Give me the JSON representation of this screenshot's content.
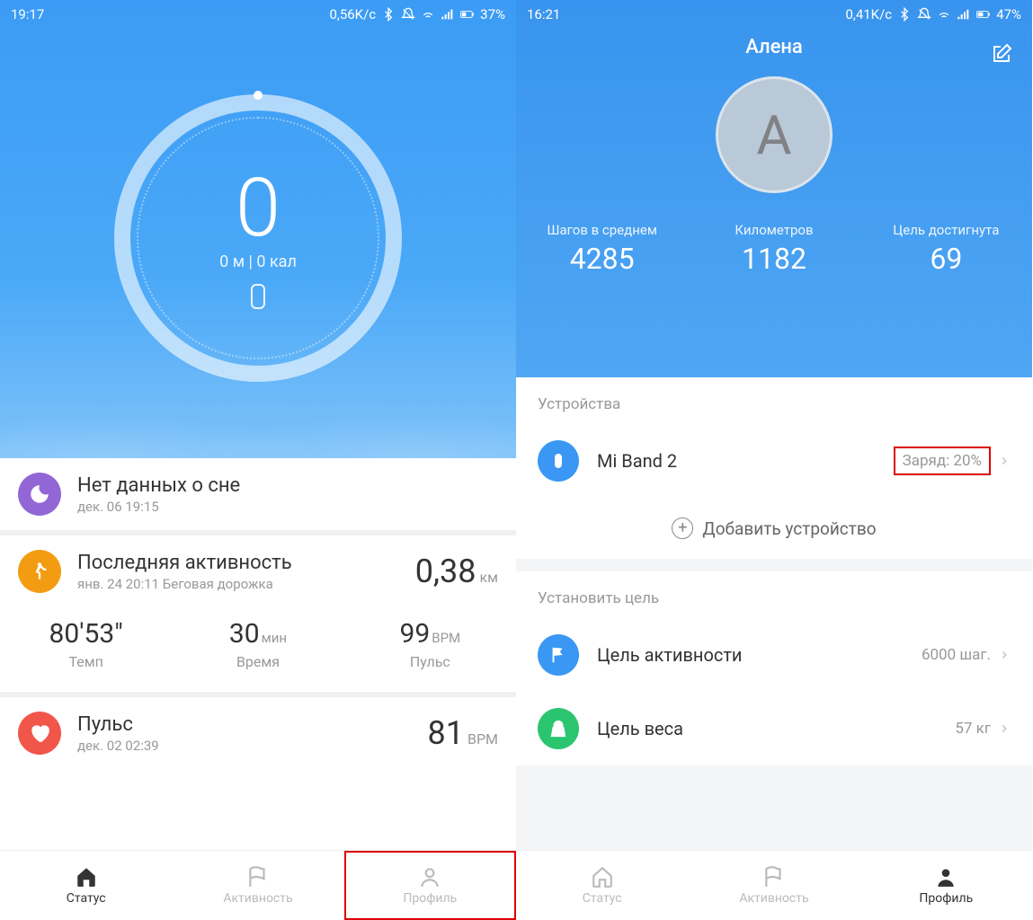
{
  "left": {
    "status": {
      "time": "19:17",
      "speed": "0,56K/c",
      "battery": "37%"
    },
    "hero": {
      "steps": "0",
      "sub": "0 м | 0 кал"
    },
    "sleep": {
      "title": "Нет данных о сне",
      "sub": "дек. 06 19:15"
    },
    "activity": {
      "title": "Последняя активность",
      "sub": "янв. 24 20:11 Беговая дорожка",
      "distance": "0,38",
      "distance_unit": "км"
    },
    "stats": {
      "pace": {
        "val": "80'53\"",
        "lab": "Темп"
      },
      "time": {
        "val": "30",
        "unit": "мин",
        "lab": "Время"
      },
      "bpm": {
        "val": "99",
        "unit": "BPM",
        "lab": "Пульс"
      }
    },
    "pulse": {
      "title": "Пульс",
      "sub": "дек. 02 02:39",
      "val": "81",
      "unit": "BPM"
    },
    "nav": {
      "status": "Статус",
      "activity": "Активность",
      "profile": "Профиль"
    }
  },
  "right": {
    "status": {
      "time": "16:21",
      "speed": "0,41K/c",
      "battery": "47%"
    },
    "profile_name": "Алена",
    "avatar_initial": "А",
    "hero_stats": {
      "s1": {
        "lab": "Шагов в среднем",
        "val": "4285"
      },
      "s2": {
        "lab": "Километров",
        "val": "1182"
      },
      "s3": {
        "lab": "Цель достигнута",
        "val": "69"
      }
    },
    "devices_header": "Устройства",
    "device": {
      "name": "Mi Band 2",
      "charge": "Заряд: 20%"
    },
    "add_device": "Добавить устройство",
    "goal_header": "Установить цель",
    "goal_activity": {
      "name": "Цель активности",
      "val": "6000 шаг."
    },
    "goal_weight": {
      "name": "Цель веса",
      "val": "57 кг"
    },
    "nav": {
      "status": "Статус",
      "activity": "Активность",
      "profile": "Профиль"
    }
  }
}
